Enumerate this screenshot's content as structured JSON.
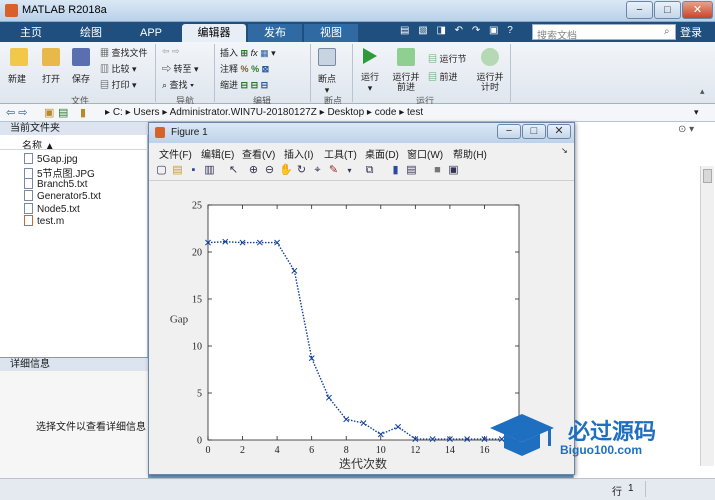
{
  "window": {
    "title": "MATLAB R2018a"
  },
  "tabs": [
    "主页",
    "绘图",
    "APP",
    "编辑器",
    "发布",
    "视图"
  ],
  "active_tab_index": 3,
  "search": {
    "placeholder": "搜索文档"
  },
  "login_label": "登录",
  "ribbon": {
    "file_group": {
      "label": "文件",
      "buttons": [
        "新建",
        "打开",
        "保存"
      ],
      "small": [
        "查找文件",
        "比较",
        "打印"
      ]
    },
    "nav_group": {
      "label": "导航",
      "small": [
        "转至",
        "查找"
      ]
    },
    "edit_group": {
      "label": "编辑",
      "small": [
        "插入",
        "注释",
        "缩进"
      ]
    },
    "bp_group": {
      "label": "断点",
      "buttons": [
        "断点"
      ]
    },
    "run_group": {
      "label": "运行",
      "buttons": [
        "运行",
        "运行并\n前进",
        "运行节",
        "前进",
        "运行并\n计时"
      ]
    }
  },
  "address": {
    "segments": [
      "C:",
      "Users",
      "Administrator.WIN7U-20180127Z",
      "Desktop",
      "code",
      "test"
    ]
  },
  "current_folder": {
    "header": "当前文件夹",
    "column": "名称 ▲",
    "files": [
      "5Gap.jpg",
      "5节点图.JPG",
      "Branch5.txt",
      "Generator5.txt",
      "Node5.txt",
      "test.m"
    ]
  },
  "details": {
    "header": "详细信息",
    "placeholder": "选择文件以查看详细信息"
  },
  "status": {
    "row_label": "行",
    "row_value": "1"
  },
  "figure": {
    "title": "Figure 1",
    "menu": [
      "文件(F)",
      "编辑(E)",
      "查看(V)",
      "插入(I)",
      "工具(T)",
      "桌面(D)",
      "窗口(W)",
      "帮助(H)"
    ]
  },
  "watermark": {
    "text": "必过源码",
    "url": "Biguo100.com"
  },
  "chart_data": {
    "type": "line",
    "xlabel": "迭代次数",
    "ylabel": "Gap",
    "xlim": [
      0,
      18
    ],
    "ylim": [
      0,
      25
    ],
    "xticks": [
      0,
      2,
      4,
      6,
      8,
      10,
      12,
      14,
      16
    ],
    "yticks": [
      0,
      5,
      10,
      15,
      20,
      25
    ],
    "marker": "x",
    "line_style": "dotted",
    "color": "#0f3f9e",
    "series": [
      {
        "x": [
          0,
          1,
          2,
          3,
          4,
          5,
          6,
          7,
          8,
          9,
          10,
          11,
          12,
          13,
          14,
          15,
          16,
          17
        ],
        "y": [
          21.0,
          21.1,
          21.0,
          21.0,
          21.0,
          18.0,
          8.7,
          4.5,
          2.2,
          1.8,
          0.6,
          1.4,
          0.1,
          0.1,
          0.1,
          0.1,
          0.1,
          0.1
        ]
      }
    ]
  }
}
